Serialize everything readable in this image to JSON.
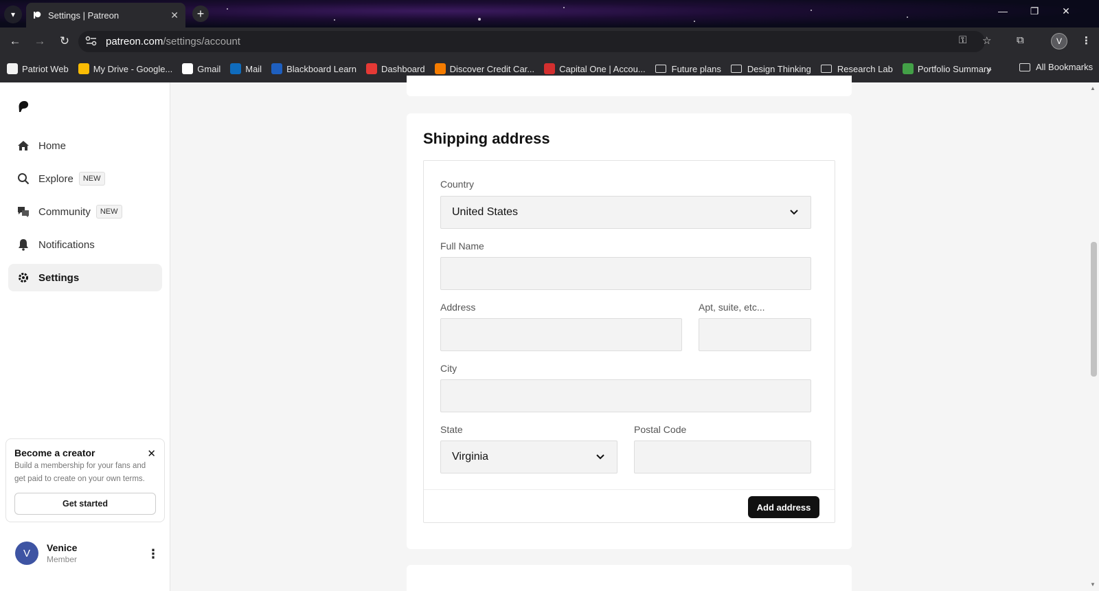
{
  "browser": {
    "tab_title": "Settings | Patreon",
    "url_domain": "patreon.com",
    "url_path": "/settings/account",
    "profile_initial": "V",
    "bookmarks": [
      {
        "label": "Patriot Web",
        "icon": "patriot-web-icon",
        "color": "#f2f2f2"
      },
      {
        "label": "My Drive - Google...",
        "icon": "google-drive-icon",
        "color": "#fbbc04"
      },
      {
        "label": "Gmail",
        "icon": "google-icon",
        "color": "#ffffff"
      },
      {
        "label": "Mail",
        "icon": "outlook-icon",
        "color": "#0f6cbd"
      },
      {
        "label": "Blackboard Learn",
        "icon": "blackboard-icon",
        "color": "#1e5fbf"
      },
      {
        "label": "Dashboard",
        "icon": "dashboard-icon",
        "color": "#e53935"
      },
      {
        "label": "Discover Credit Car...",
        "icon": "discover-icon",
        "color": "#f57c00"
      },
      {
        "label": "Capital One | Accou...",
        "icon": "capital-one-icon",
        "color": "#d32f2f"
      },
      {
        "label": "Future plans",
        "icon": "folder-icon",
        "color": ""
      },
      {
        "label": "Design Thinking",
        "icon": "folder-icon",
        "color": ""
      },
      {
        "label": "Research Lab",
        "icon": "folder-icon",
        "color": ""
      },
      {
        "label": "Portfolio Summary",
        "icon": "portfolio-icon",
        "color": "#43a047"
      }
    ],
    "all_bookmarks": "All Bookmarks"
  },
  "sidebar": {
    "nav": [
      {
        "label": "Home",
        "icon": "home-icon",
        "badge": ""
      },
      {
        "label": "Explore",
        "icon": "search-icon",
        "badge": "NEW"
      },
      {
        "label": "Community",
        "icon": "chat-icon",
        "badge": "NEW"
      },
      {
        "label": "Notifications",
        "icon": "bell-icon",
        "badge": ""
      },
      {
        "label": "Settings",
        "icon": "gear-icon",
        "badge": ""
      }
    ],
    "creator_card": {
      "title": "Become a creator",
      "text": "Build a membership for your fans and get paid to create on your own terms.",
      "button": "Get started"
    },
    "user": {
      "initial": "V",
      "name": "Venice",
      "role": "Member"
    }
  },
  "shipping": {
    "title": "Shipping address",
    "country_label": "Country",
    "country_value": "United States",
    "full_name_label": "Full Name",
    "full_name_value": "",
    "address_label": "Address",
    "address_value": "",
    "apt_label": "Apt, suite, etc...",
    "apt_value": "",
    "city_label": "City",
    "city_value": "",
    "state_label": "State",
    "state_value": "Virginia",
    "postal_label": "Postal Code",
    "postal_value": "",
    "submit": "Add address"
  },
  "colors": {
    "accent": "#111111",
    "avatar": "#3e54a3"
  }
}
